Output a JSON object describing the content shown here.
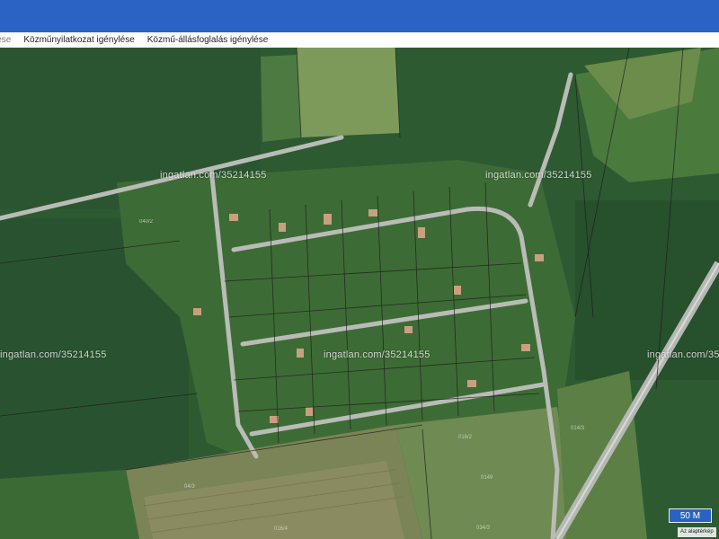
{
  "menu": {
    "items": [
      {
        "label": "lése"
      },
      {
        "label": "Közműnyilatkozat igénylése"
      },
      {
        "label": "Közmű-állásfoglalás igénylése"
      }
    ]
  },
  "map": {
    "watermark": "ingatlan.com/35214155",
    "scale_label": "50 M",
    "basemap_label": "Az alaptérkép",
    "parcel_numbers": [
      "040/2",
      "0149",
      "016/2",
      "016/4",
      "034/3",
      "014/3",
      "04/3"
    ]
  },
  "colors": {
    "header": "#2a63c3",
    "forest": "#2e5b32",
    "field": "#7e8a5e",
    "road": "#b9bcb6",
    "parcel_line": "#1d1d1d"
  }
}
